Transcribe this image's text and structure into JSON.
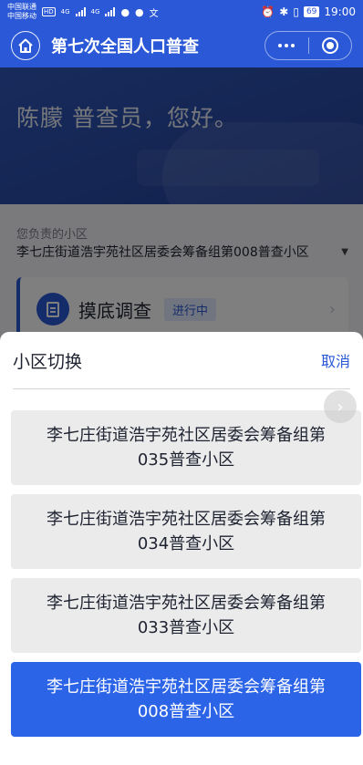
{
  "status_bar": {
    "carrier1": "中国联通",
    "hd_badge": "HD",
    "carrier2": "中国移动",
    "network1": "4G",
    "network2": "4G",
    "battery": "69",
    "time": "19:00"
  },
  "nav": {
    "title": "第七次全国人口普查"
  },
  "background_page": {
    "greeting": "陈朦 普查员，您好。",
    "community_label": "您负责的小区",
    "community_value": "李七庄街道浩宇苑社区居委会筹备组第008普查小区",
    "task_title": "摸底调查",
    "task_status": "进行中"
  },
  "sheet": {
    "title": "小区切换",
    "cancel_label": "取消",
    "options": [
      {
        "line1": "李七庄街道浩宇苑社区居委会筹备组第",
        "line2": "035普查小区",
        "selected": false
      },
      {
        "line1": "李七庄街道浩宇苑社区居委会筹备组第",
        "line2": "034普查小区",
        "selected": false
      },
      {
        "line1": "李七庄街道浩宇苑社区居委会筹备组第",
        "line2": "033普查小区",
        "selected": false
      },
      {
        "line1": "李七庄街道浩宇苑社区居委会筹备组第",
        "line2": "008普查小区",
        "selected": true
      }
    ]
  },
  "colors": {
    "primary": "#2a58d6",
    "selected_option": "#2c64e8",
    "option_bg": "#ebebeb"
  }
}
